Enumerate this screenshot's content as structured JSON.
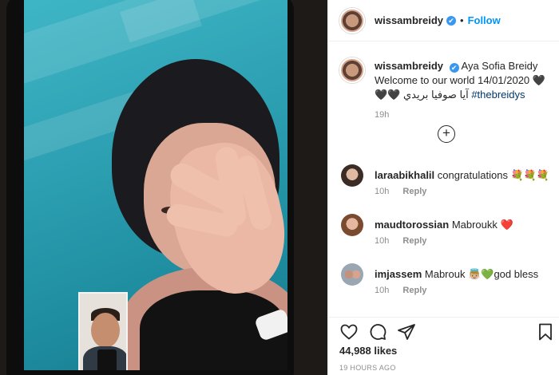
{
  "post": {
    "username": "wissambreidy",
    "verified_mark": "✔",
    "separator": "•",
    "follow_label": "Follow",
    "caption_line1": "Aya Sofia Breidy",
    "caption_line2": "Welcome to our world 14/01/2020 🖤",
    "caption_line3": "🖤🖤 آيا صوفيا بريدي",
    "hashtag": "#thebreidys",
    "caption_time": "19h",
    "load_more_icon": "plus-circle-icon",
    "likes": "44,988 likes",
    "posted_ago": "19 HOURS AGO"
  },
  "comments": [
    {
      "username": "laraabikhalil",
      "text": "congratulations 💐💐💐",
      "time": "10h",
      "reply": "Reply"
    },
    {
      "username": "maudtorossian",
      "text": "Mabroukk ❤️",
      "time": "10h",
      "reply": "Reply"
    },
    {
      "username": "imjassem",
      "text": "Mabrouk 👼🏼💚god bless",
      "time": "10h",
      "reply": "Reply"
    }
  ],
  "icons": {
    "like": "heart-icon",
    "comment": "comment-icon",
    "share": "share-icon",
    "save": "bookmark-icon"
  },
  "colors": {
    "link": "#0095f6",
    "verified": "#3897f0",
    "hashtag": "#00376b",
    "heart": "#ed4956"
  }
}
